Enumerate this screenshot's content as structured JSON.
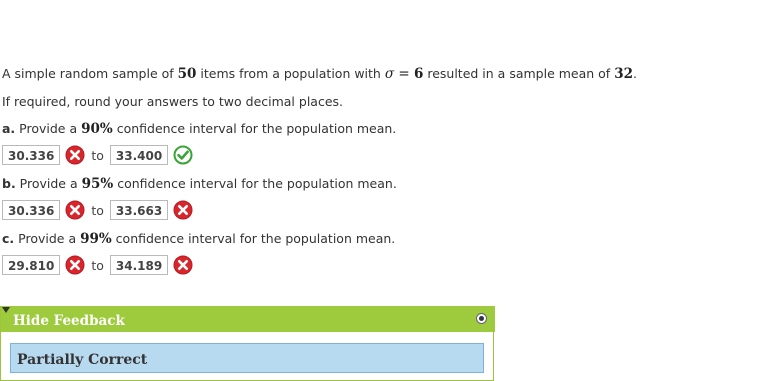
{
  "question": {
    "intro_before_n": "A simple random sample of ",
    "n": "50",
    "intro_mid": " items from a population with ",
    "sigma_symbol": "σ",
    "equals": " = ",
    "sigma_value": "6",
    "intro_after": " resulted in a sample mean of ",
    "mean_value": "32",
    "period": ".",
    "rounding_note": "If required, round your answers to two decimal places."
  },
  "parts": [
    {
      "letter": "a.",
      "prefix": " Provide a ",
      "level": "90%",
      "suffix": " confidence interval for the population mean.",
      "lower": "30.336",
      "lower_status": "incorrect",
      "to_label": "to",
      "upper": "33.400",
      "upper_status": "correct"
    },
    {
      "letter": "b.",
      "prefix": " Provide a ",
      "level": "95%",
      "suffix": " confidence interval for the population mean.",
      "lower": "30.336",
      "lower_status": "incorrect",
      "to_label": "to",
      "upper": "33.663",
      "upper_status": "incorrect"
    },
    {
      "letter": "c.",
      "prefix": " Provide a ",
      "level": "99%",
      "suffix": " confidence interval for the population mean.",
      "lower": "29.810",
      "lower_status": "incorrect",
      "to_label": "to",
      "upper": "34.189",
      "upper_status": "incorrect"
    }
  ],
  "feedback": {
    "header": "Hide Feedback",
    "status": "Partially Correct"
  },
  "colors": {
    "incorrect_mark": "#d9262d",
    "correct_mark": "#3aa335",
    "feedback_header": "#9ecb3d",
    "status_bg": "#b7daf0"
  },
  "icons": {
    "incorrect": "x-circle-icon",
    "correct": "check-circle-icon",
    "toggle": "radio-toggle-icon"
  }
}
